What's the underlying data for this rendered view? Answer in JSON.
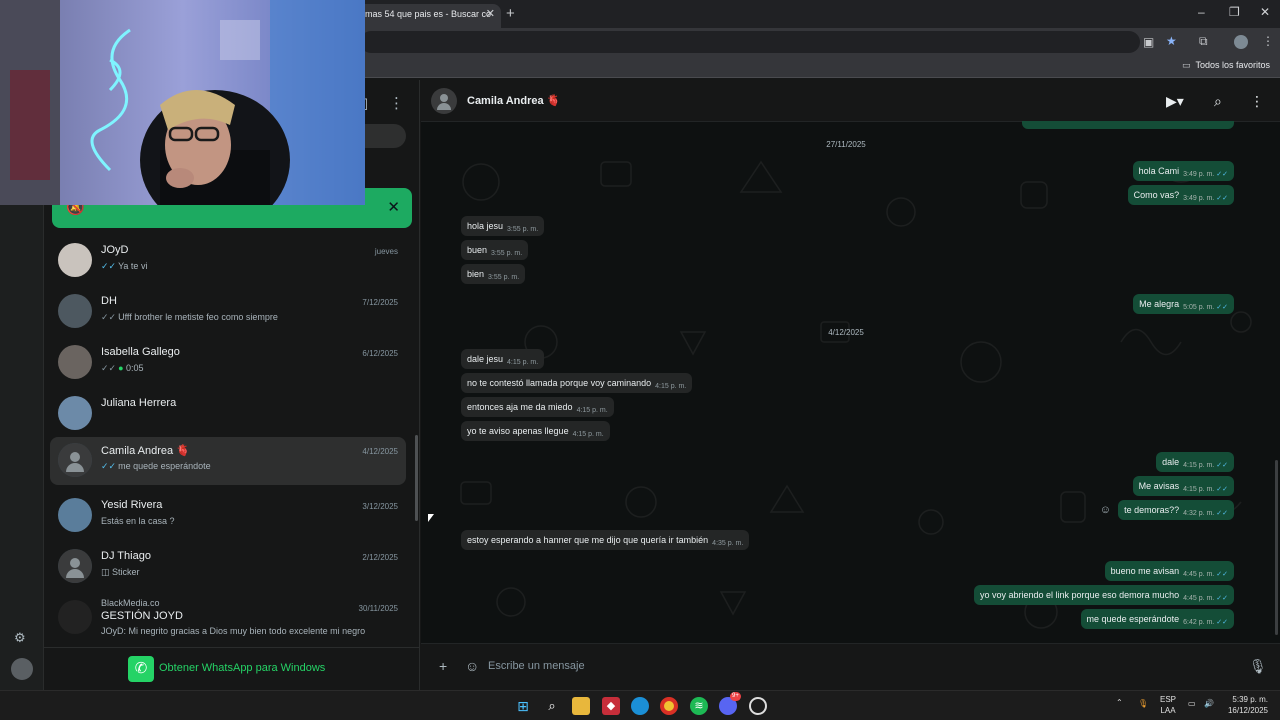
{
  "browser": {
    "tab_title": "mas 54 que pais es - Buscar co",
    "bookmarks_label": "Todos los favoritos"
  },
  "sidebar": {
    "chats": [
      {
        "name": "JOyD",
        "time": "jueves",
        "preview": "Ya te vi",
        "tick": "blue",
        "avatar": "photo"
      },
      {
        "name": "DH",
        "time": "7/12/2025",
        "preview": "Ufff brother le metiste feo como siempre",
        "tick": "grey",
        "avatar": "photo"
      },
      {
        "name": "Isabella Gallego",
        "time": "6/12/2025",
        "preview": "0:05",
        "tick": "grey",
        "mic": true,
        "avatar": "photo"
      },
      {
        "name": "Juliana Herrera",
        "time": "",
        "preview": "",
        "tick": "none",
        "avatar": "photo"
      },
      {
        "name": "Camila Andrea 🫀",
        "time": "4/12/2025",
        "preview": "me quede esperándote",
        "tick": "blue",
        "avatar": "generic",
        "selected": true
      },
      {
        "name": "Yesid Rivera",
        "time": "3/12/2025",
        "preview": "Estás en la casa ?",
        "tick": "none",
        "avatar": "photo"
      },
      {
        "name": "DJ Thiago",
        "time": "2/12/2025",
        "preview": "Sticker",
        "tick": "none",
        "sticker": true,
        "avatar": "generic"
      },
      {
        "name": "GESTIÓN JOYD",
        "group_label": "BlackMedia.co",
        "time": "30/11/2025",
        "preview": "JOyD: Mi negrito gracias a Dios muy bien todo excelente mi negro",
        "tick": "none",
        "avatar": "photo"
      }
    ],
    "get_app_label": "Obtener WhatsApp para Windows"
  },
  "conversation": {
    "contact_name": "Camila Andrea 🫀",
    "composer_placeholder": "Escribe un mensaje",
    "dates": [
      "27/11/2025",
      "4/12/2025"
    ],
    "messages": [
      {
        "dir": "out",
        "text": "hola Cami",
        "time": "3:49 p. m."
      },
      {
        "dir": "out",
        "text": "Como vas?",
        "time": "3:49 p. m."
      },
      {
        "dir": "in",
        "text": "hola jesu",
        "time": "3:55 p. m."
      },
      {
        "dir": "in",
        "text": "buen",
        "time": "3:55 p. m."
      },
      {
        "dir": "in",
        "text": "bien",
        "time": "3:55 p. m."
      },
      {
        "dir": "out",
        "text": "Me alegra",
        "time": "5:05 p. m."
      },
      {
        "dir": "in",
        "text": "dale jesu",
        "time": "4:15 p. m."
      },
      {
        "dir": "in",
        "text": "no te contestó llamada porque voy caminando",
        "time": "4:15 p. m."
      },
      {
        "dir": "in",
        "text": "entonces aja me da miedo",
        "time": "4:15 p. m."
      },
      {
        "dir": "in",
        "text": "yo te aviso apenas llegue",
        "time": "4:15 p. m."
      },
      {
        "dir": "out",
        "text": "dale",
        "time": "4:15 p. m."
      },
      {
        "dir": "out",
        "text": "Me avisas",
        "time": "4:15 p. m."
      },
      {
        "dir": "out",
        "text": "te demoras??",
        "time": "4:32 p. m."
      },
      {
        "dir": "in",
        "text": "estoy esperando a hanner que me dijo que quería ir también",
        "time": "4:35 p. m."
      },
      {
        "dir": "out",
        "text": "bueno me avisan",
        "time": "4:45 p. m."
      },
      {
        "dir": "out",
        "text": "yo voy abriendo el link porque eso demora mucho",
        "time": "4:45 p. m."
      },
      {
        "dir": "out",
        "text": "me quede esperándote",
        "time": "6:42 p. m."
      }
    ]
  },
  "taskbar": {
    "lang_top": "ESP",
    "lang_bottom": "LAA",
    "time": "5:39 p. m.",
    "date": "16/12/2025",
    "discord_badge": "9+"
  },
  "colors": {
    "accent": "#25d366",
    "bubble_out": "#144d37",
    "bubble_in": "#242626",
    "read_tick": "#53bdeb"
  }
}
